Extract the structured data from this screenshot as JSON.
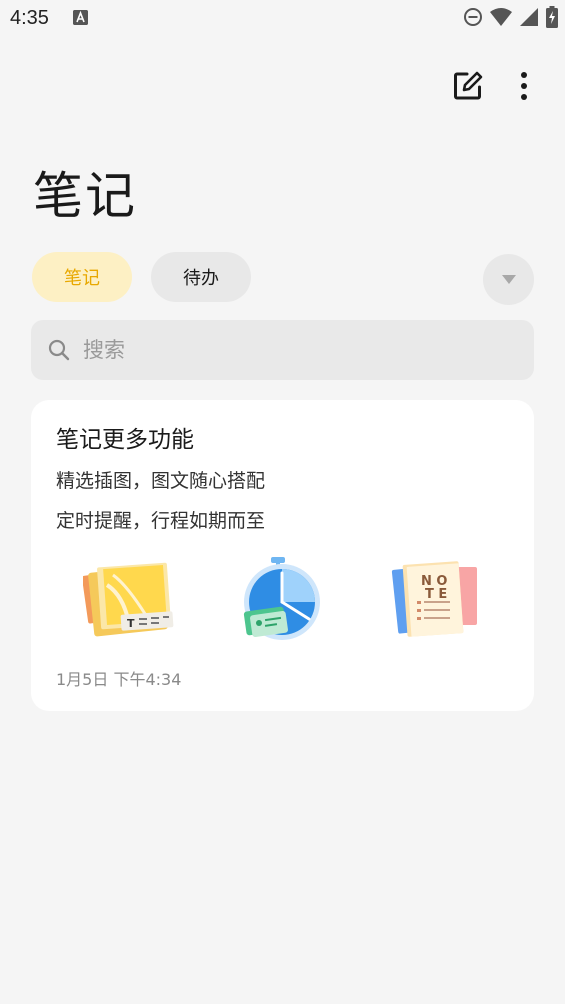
{
  "status_bar": {
    "time": "4:35",
    "icons": [
      "app-notification-icon",
      "do-not-disturb-icon",
      "wifi-icon",
      "cell-signal-icon",
      "battery-charging-icon"
    ]
  },
  "toolbar": {
    "edit_icon": "edit-note-icon",
    "more_icon": "more-vertical-icon"
  },
  "page": {
    "title": "笔记"
  },
  "tabs": [
    {
      "label": "笔记",
      "selected": true
    },
    {
      "label": "待办",
      "selected": false
    }
  ],
  "dropdown_icon": "caret-down-icon",
  "search": {
    "placeholder": "搜索",
    "value": ""
  },
  "note": {
    "title": "笔记更多功能",
    "lines": [
      "精选插图，图文随心搭配",
      "定时提醒，行程如期而至"
    ],
    "date": "1月5日  下午4:34",
    "illustrations": [
      "picture-book-icon",
      "stopwatch-icon",
      "notepad-icon"
    ],
    "illustration_text": "NOTE"
  },
  "colors": {
    "accent": "#e8a800",
    "accent_bg": "#fdf0c4",
    "background": "#f5f5f5"
  }
}
